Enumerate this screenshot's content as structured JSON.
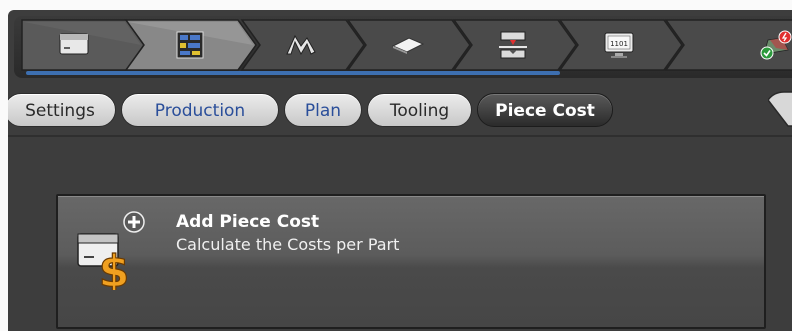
{
  "workflow": {
    "steps": [
      {
        "name": "part-setup",
        "icon": "panel-icon"
      },
      {
        "name": "production",
        "icon": "nesting-sheet-icon"
      },
      {
        "name": "bending",
        "icon": "bend-profile-icon"
      },
      {
        "name": "blank",
        "icon": "flat-blank-icon"
      },
      {
        "name": "tooling",
        "icon": "press-brake-icon"
      },
      {
        "name": "nc-output",
        "icon": "monitor-1101-icon",
        "monitor_text": "1101"
      },
      {
        "name": "status",
        "icon": "check-error-status-icon"
      }
    ],
    "progress_color": "#3d6fb0"
  },
  "tabs": [
    {
      "label": "Settings",
      "state": "normal"
    },
    {
      "label": "Production",
      "state": "highlight"
    },
    {
      "label": "Plan",
      "state": "highlight"
    },
    {
      "label": "Tooling",
      "state": "normal"
    },
    {
      "label": "Piece Cost",
      "state": "active"
    }
  ],
  "card": {
    "title": "Add Piece Cost",
    "subtitle": "Calculate the Costs per Part",
    "icon": "add-piece-cost-icon"
  },
  "colors": {
    "background": "#3d3d3d",
    "accent_blue": "#2a4e9a",
    "dollar_orange": "#f0a020"
  }
}
